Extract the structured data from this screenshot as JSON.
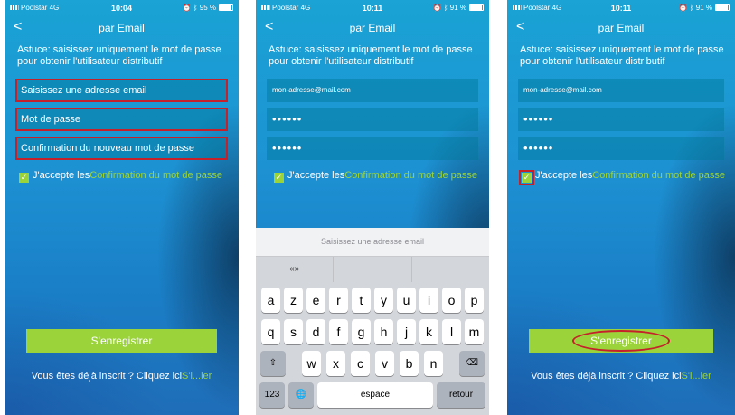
{
  "status": {
    "carrier": "Poolstar",
    "network": "4G",
    "screens": [
      {
        "time": "10:04",
        "battery": "95 %"
      },
      {
        "time": "10:11",
        "battery": "91 %"
      },
      {
        "time": "10:11",
        "battery": "91 %"
      }
    ]
  },
  "nav": {
    "back": "<",
    "title": "par Email"
  },
  "hint": "Astuce: saisissez uniquement le mot de passe pour obtenir l'utilisateur distributif",
  "screen1": {
    "email_placeholder": "Saisissez une adresse email",
    "password_placeholder": "Mot de passe",
    "confirm_placeholder": "Confirmation du nouveau mot de passe"
  },
  "screen2": {
    "email_value": "mon-adresse@mail.com",
    "password_value": "••••••",
    "confirm_value": "••••••"
  },
  "screen3": {
    "email_value": "mon-adresse@mail.com",
    "password_value": "••••••",
    "confirm_value": "••••••"
  },
  "accept": {
    "prefix": "J'accepte les",
    "link": "Confirmation du mot de passe",
    "checkmark": "✓"
  },
  "register_button": "S'enregistrer",
  "already": {
    "text": "Vous êtes déjà inscrit ? Cliquez ici",
    "link": "S'i...ier"
  },
  "keyboard": {
    "input_hint": "Saisissez une adresse email",
    "predictions": [
      "«»",
      "",
      ""
    ],
    "row1": [
      "a",
      "z",
      "e",
      "r",
      "t",
      "y",
      "u",
      "i",
      "o",
      "p"
    ],
    "row2": [
      "q",
      "s",
      "d",
      "f",
      "g",
      "h",
      "j",
      "k",
      "l",
      "m"
    ],
    "row3": [
      "w",
      "x",
      "c",
      "v",
      "b",
      "n"
    ],
    "shift": "⇧",
    "backspace": "⌫",
    "numbers": "123",
    "globe": "🌐",
    "space": "espace",
    "return": "retour"
  },
  "colors": {
    "accent_green": "#9bd33b",
    "highlight_red": "#c4212b",
    "background_blue": "#1a8fd0"
  }
}
